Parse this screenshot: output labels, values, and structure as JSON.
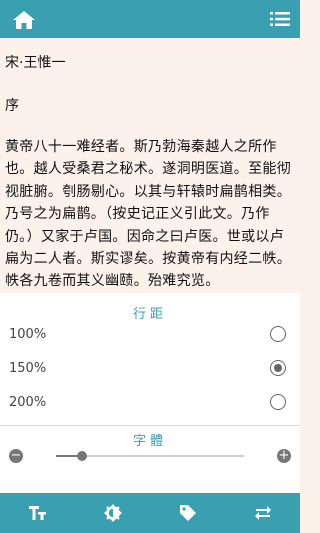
{
  "header": {
    "home_icon": "home-icon",
    "menu_icon": "list-icon"
  },
  "article": {
    "author": "宋·王惟一",
    "heading": "序",
    "paragraph": "黄帝八十一难经者。斯乃勃海秦越人之所作也。越人受桑君之秘术。遂洞明医道。至能彻视脏腑。刳肠剔心。以其与轩辕时扁鹊相类。乃号之为扁鹊。（按史记正义引此文。乃作仍。）又家于卢国。因命之曰卢医。世或以卢扁为二人者。斯实谬矣。按黄帝有内经二帙。帙各九卷而其义幽赜。殆难究览。"
  },
  "line_spacing": {
    "title": "行距",
    "options": [
      {
        "label": "100%",
        "selected": false
      },
      {
        "label": "150%",
        "selected": true
      },
      {
        "label": "200%",
        "selected": false
      }
    ]
  },
  "font_size": {
    "title": "字體",
    "slider_level": 0.14,
    "minus_label": "−",
    "plus_label": "+"
  },
  "bottom_bar": [
    "font-size-icon",
    "brightness-icon",
    "tag-icon",
    "swap-icon"
  ],
  "colors": {
    "accent": "#3a9fb0",
    "paper": "#fdf1eb"
  }
}
